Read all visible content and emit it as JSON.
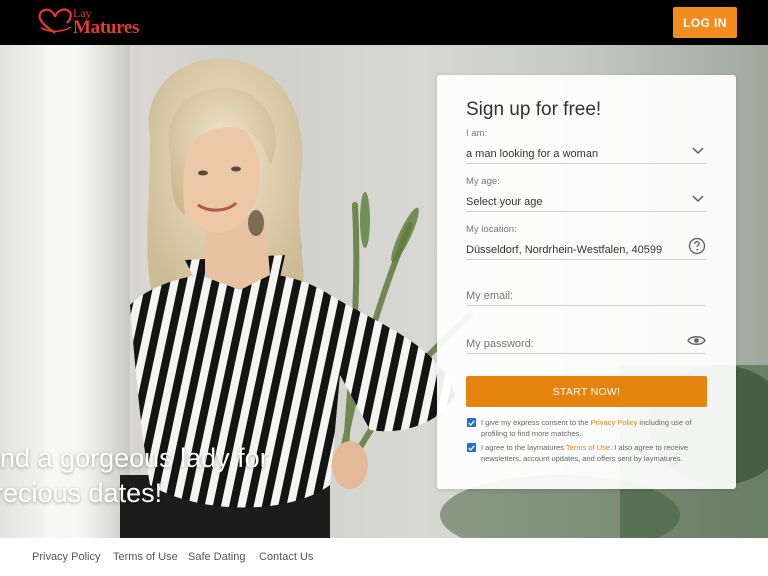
{
  "header": {
    "logo_line1": "Lay",
    "logo_line2": "Matures",
    "login_label": "LOG IN"
  },
  "hero": {
    "headline_line1": "ind a gorgeous lady for",
    "headline_line2": "recious dates!"
  },
  "form": {
    "title": "Sign up for free!",
    "iam": {
      "label": "I am:",
      "value": "a man looking for a woman"
    },
    "age": {
      "label": "My age:",
      "value": "Select your age"
    },
    "location": {
      "label": "My location:",
      "value": "Düsseldorf, Nordrhein-Westfalen, 40599"
    },
    "email": {
      "placeholder": "My email:"
    },
    "password": {
      "placeholder": "My password:"
    },
    "start_label": "START NOW!",
    "consent1": {
      "pre": "I give my express consent to the ",
      "link": "Privacy Policy",
      "post": " including use of profiling to find more matches."
    },
    "consent2": {
      "pre": "I agree to the laymatures ",
      "link": "Terms of Use",
      "post": ". I also agree to receive newsletters, account updates, and offers sent by laymatures."
    }
  },
  "footer": {
    "links": [
      "Privacy Policy",
      "Terms of Use",
      "Safe Dating",
      "Contact Us"
    ]
  },
  "colors": {
    "accent": "#e5830f",
    "login": "#f28c1e",
    "logo": "#e63a2a",
    "checkbox": "#1e6fd9"
  },
  "icons": [
    "heart-logo-icon",
    "chevron-down-icon",
    "help-circle-icon",
    "eye-icon",
    "check-icon"
  ]
}
